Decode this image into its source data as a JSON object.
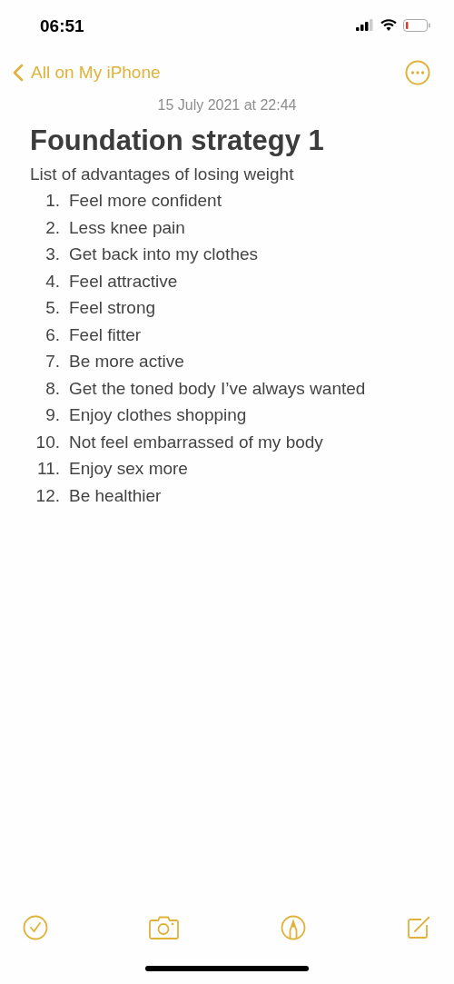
{
  "status_bar": {
    "time": "06:51"
  },
  "nav": {
    "back_label": "All on My iPhone"
  },
  "note": {
    "date": "15 July 2021 at 22:44",
    "title": "Foundation strategy 1",
    "intro": "List of advantages of losing weight",
    "items": [
      {
        "number": "1.",
        "text": "Feel more confident"
      },
      {
        "number": "2.",
        "text": "Less knee pain"
      },
      {
        "number": "3.",
        "text": "Get back into my clothes"
      },
      {
        "number": "4.",
        "text": "Feel attractive"
      },
      {
        "number": "5.",
        "text": "Feel strong"
      },
      {
        "number": "6.",
        "text": "Feel fitter"
      },
      {
        "number": "7.",
        "text": "Be more active"
      },
      {
        "number": "8.",
        "text": "Get the toned body I’ve always wanted"
      },
      {
        "number": "9.",
        "text": "Enjoy clothes shopping"
      },
      {
        "number": "10.",
        "text": "Not feel embarrassed of my body"
      },
      {
        "number": "11.",
        "text": "Enjoy sex more"
      },
      {
        "number": "12.",
        "text": "Be healthier"
      }
    ]
  }
}
